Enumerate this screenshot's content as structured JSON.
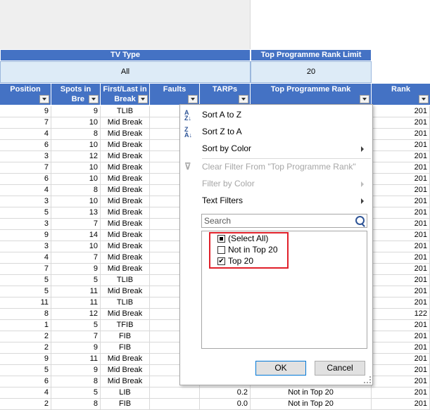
{
  "filters": {
    "tv_type": {
      "header": "TV Type",
      "value": "All"
    },
    "rank_limit": {
      "header": "Top Programme Rank Limit",
      "value": "20"
    }
  },
  "columns": [
    {
      "label": "Position",
      "lines": [
        "Position",
        ""
      ]
    },
    {
      "label": "Spots in Break",
      "lines": [
        "Spots in",
        "Bre"
      ]
    },
    {
      "label": "First/Last in Break",
      "lines": [
        "First/Last in",
        "Break"
      ]
    },
    {
      "label": "Faults",
      "lines": [
        "Faults",
        ""
      ]
    },
    {
      "label": "TARPs",
      "lines": [
        "TARPs",
        ""
      ]
    },
    {
      "label": "Top Programme Rank",
      "lines": [
        "Top Programme Rank",
        ""
      ]
    },
    {
      "label": "Rank",
      "lines": [
        "Rank",
        ""
      ]
    }
  ],
  "rows": [
    {
      "position": "9",
      "spots": "9",
      "first_last": "TLIB",
      "faults": "",
      "tarps": "",
      "top": "",
      "rank": "201"
    },
    {
      "position": "7",
      "spots": "10",
      "first_last": "Mid Break",
      "faults": "",
      "tarps": "",
      "top": "",
      "rank": "201"
    },
    {
      "position": "4",
      "spots": "8",
      "first_last": "Mid Break",
      "faults": "",
      "tarps": "",
      "top": "",
      "rank": "201"
    },
    {
      "position": "6",
      "spots": "10",
      "first_last": "Mid Break",
      "faults": "",
      "tarps": "",
      "top": "",
      "rank": "201"
    },
    {
      "position": "3",
      "spots": "12",
      "first_last": "Mid Break",
      "faults": "",
      "tarps": "",
      "top": "",
      "rank": "201"
    },
    {
      "position": "7",
      "spots": "10",
      "first_last": "Mid Break",
      "faults": "",
      "tarps": "",
      "top": "",
      "rank": "201"
    },
    {
      "position": "6",
      "spots": "10",
      "first_last": "Mid Break",
      "faults": "",
      "tarps": "",
      "top": "",
      "rank": "201"
    },
    {
      "position": "4",
      "spots": "8",
      "first_last": "Mid Break",
      "faults": "",
      "tarps": "",
      "top": "",
      "rank": "201"
    },
    {
      "position": "3",
      "spots": "10",
      "first_last": "Mid Break",
      "faults": "",
      "tarps": "",
      "top": "",
      "rank": "201"
    },
    {
      "position": "5",
      "spots": "13",
      "first_last": "Mid Break",
      "faults": "",
      "tarps": "",
      "top": "",
      "rank": "201"
    },
    {
      "position": "3",
      "spots": "7",
      "first_last": "Mid Break",
      "faults": "",
      "tarps": "",
      "top": "",
      "rank": "201"
    },
    {
      "position": "9",
      "spots": "14",
      "first_last": "Mid Break",
      "faults": "",
      "tarps": "",
      "top": "",
      "rank": "201"
    },
    {
      "position": "3",
      "spots": "10",
      "first_last": "Mid Break",
      "faults": "",
      "tarps": "",
      "top": "",
      "rank": "201"
    },
    {
      "position": "4",
      "spots": "7",
      "first_last": "Mid Break",
      "faults": "",
      "tarps": "",
      "top": "",
      "rank": "201"
    },
    {
      "position": "7",
      "spots": "9",
      "first_last": "Mid Break",
      "faults": "",
      "tarps": "",
      "top": "",
      "rank": "201"
    },
    {
      "position": "5",
      "spots": "5",
      "first_last": "TLIB",
      "faults": "",
      "tarps": "",
      "top": "",
      "rank": "201"
    },
    {
      "position": "5",
      "spots": "11",
      "first_last": "Mid Break",
      "faults": "",
      "tarps": "",
      "top": "",
      "rank": "201"
    },
    {
      "position": "11",
      "spots": "11",
      "first_last": "TLIB",
      "faults": "",
      "tarps": "",
      "top": "",
      "rank": "201"
    },
    {
      "position": "8",
      "spots": "12",
      "first_last": "Mid Break",
      "faults": "",
      "tarps": "",
      "top": "",
      "rank": "122"
    },
    {
      "position": "1",
      "spots": "5",
      "first_last": "TFIB",
      "faults": "",
      "tarps": "",
      "top": "",
      "rank": "201"
    },
    {
      "position": "2",
      "spots": "7",
      "first_last": "FIB",
      "faults": "",
      "tarps": "",
      "top": "",
      "rank": "201"
    },
    {
      "position": "2",
      "spots": "9",
      "first_last": "FIB",
      "faults": "",
      "tarps": "",
      "top": "",
      "rank": "201"
    },
    {
      "position": "9",
      "spots": "11",
      "first_last": "Mid Break",
      "faults": "",
      "tarps": "",
      "top": "",
      "rank": "201"
    },
    {
      "position": "5",
      "spots": "9",
      "first_last": "Mid Break",
      "faults": "",
      "tarps": "",
      "top": "",
      "rank": "201"
    },
    {
      "position": "6",
      "spots": "8",
      "first_last": "Mid Break",
      "faults": "",
      "tarps": "",
      "top": "",
      "rank": "201"
    },
    {
      "position": "4",
      "spots": "5",
      "first_last": "LIB",
      "faults": "",
      "tarps": "0.2",
      "top": "Not in Top 20",
      "rank": "201"
    },
    {
      "position": "2",
      "spots": "8",
      "first_last": "FIB",
      "faults": "",
      "tarps": "0.0",
      "top": "Not in Top 20",
      "rank": "201"
    }
  ],
  "menu": {
    "sort_az": "Sort A to Z",
    "sort_za": "Sort Z to A",
    "sort_color": "Sort by Color",
    "clear_filter": "Clear Filter From \"Top Programme Rank\"",
    "filter_color": "Filter by Color",
    "text_filters": "Text Filters",
    "search_placeholder": "Search",
    "items": [
      {
        "label": "(Select All)",
        "state": "partial"
      },
      {
        "label": "Not in Top 20",
        "state": "unchecked"
      },
      {
        "label": "Top 20",
        "state": "checked"
      }
    ],
    "ok": "OK",
    "cancel": "Cancel"
  },
  "colors": {
    "header_blue": "#4472c4",
    "light_blue": "#ddebf7",
    "highlight_red": "#e0202a"
  }
}
